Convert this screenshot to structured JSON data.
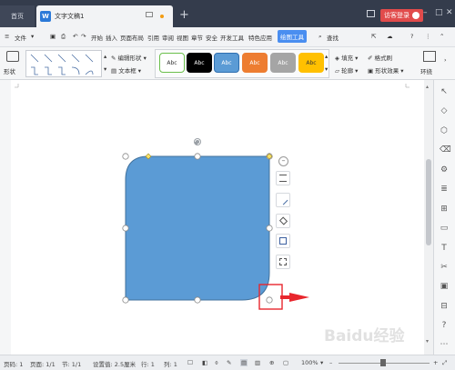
{
  "titlebar": {
    "home_tab": "首页",
    "doc_tab": "文字文稿1",
    "doc_logo": "W",
    "user_button": "访客登录",
    "add_tab": "+",
    "minimize": "–",
    "maximize": "□",
    "close": "✕"
  },
  "menubar": {
    "file_label": "文件",
    "items": [
      "开始",
      "插入",
      "页面布局",
      "引用",
      "审阅",
      "视图",
      "章节",
      "安全",
      "开发工具",
      "特色应用"
    ],
    "active_tab": "绘图工具",
    "search": "查找"
  },
  "ribbon": {
    "shape_label": "形状",
    "edit_shape": "编辑形状",
    "textbox": "文本框",
    "style_buttons": [
      {
        "label": "Abc",
        "bg": "#ffffff",
        "fg": "#333333",
        "border": "#6abf4b"
      },
      {
        "label": "Abc",
        "bg": "#000000",
        "fg": "#ffffff",
        "border": "#000000"
      },
      {
        "label": "Abc",
        "bg": "#5b9bd5",
        "fg": "#ffffff",
        "border": "#2f6fb0"
      },
      {
        "label": "Abc",
        "bg": "#ed7d31",
        "fg": "#ffffff",
        "border": "#ed7d31"
      },
      {
        "label": "Abc",
        "bg": "#a5a5a5",
        "fg": "#ffffff",
        "border": "#a5a5a5"
      },
      {
        "label": "Abc",
        "bg": "#ffc000",
        "fg": "#333333",
        "border": "#ffc000"
      }
    ],
    "fill": "填充",
    "format_painter": "格式刷",
    "outline": "轮廓",
    "shape_effects": "形状效果",
    "wrap": "环绕"
  },
  "canvas": {
    "shape_fill": "#5b9bd5",
    "shape_stroke": "#41719c",
    "highlight_color": "#e8262d"
  },
  "statusbar": {
    "page": "页码: 1",
    "pages": "页面: 1/1",
    "section": "节: 1/1",
    "setting": "设置值: 2.5厘米",
    "row": "行: 1",
    "col": "列: 1",
    "zoom": "100%",
    "zoom_minus": "–",
    "zoom_plus": "+"
  },
  "watermark": "Baidu经验"
}
